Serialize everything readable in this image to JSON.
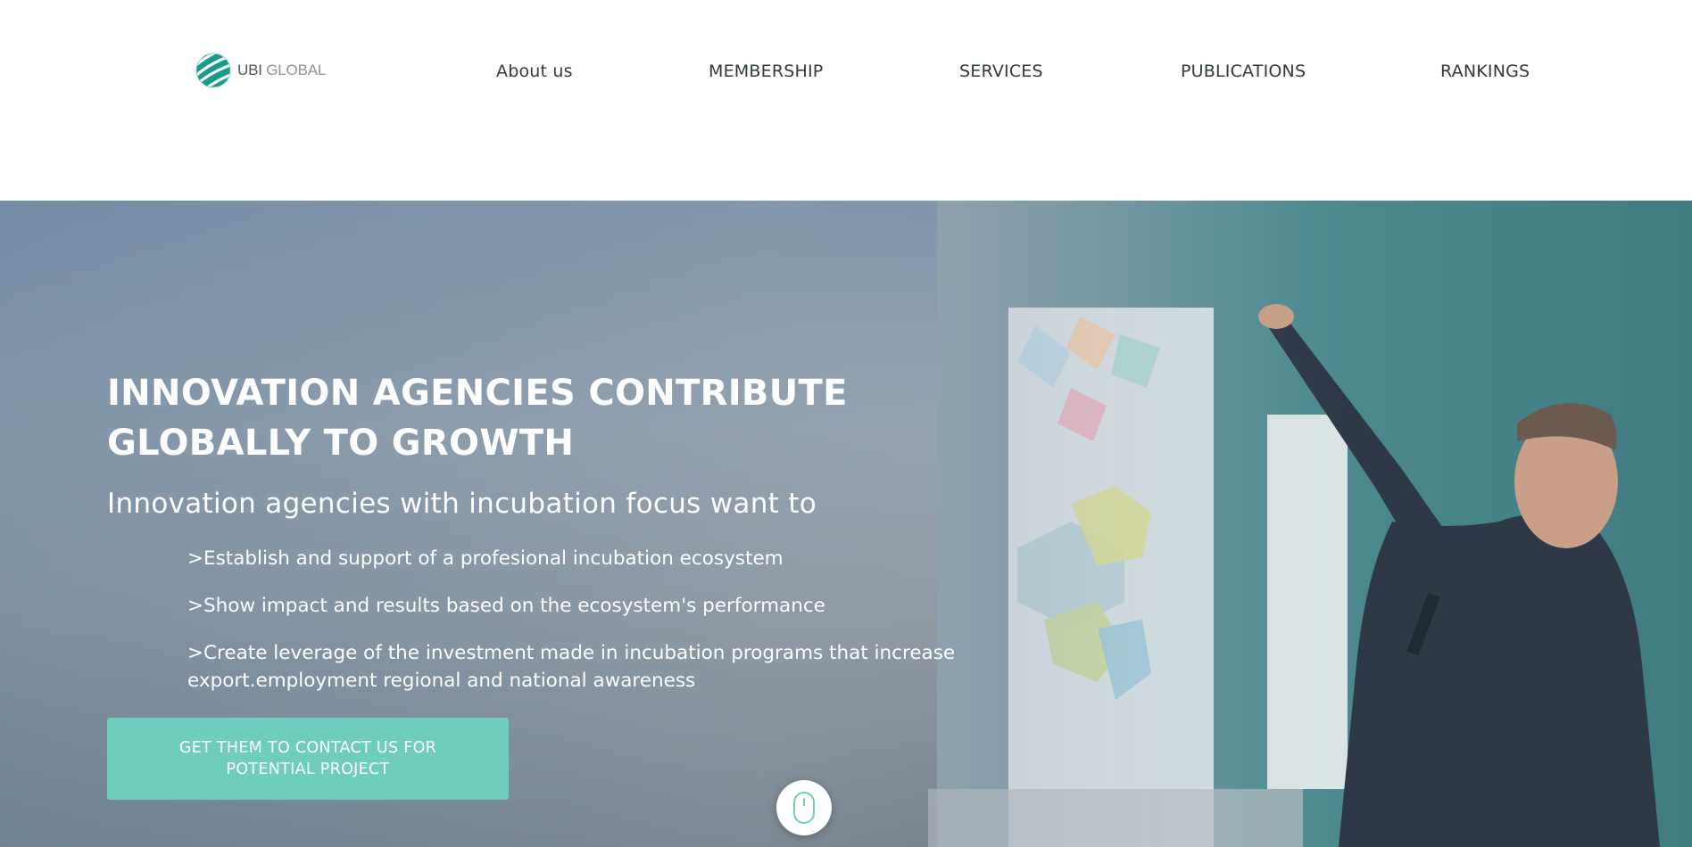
{
  "brand": {
    "logo_text_a": "UBI",
    "logo_text_b": " GLOBAL",
    "accent_color": "#6fcdbd",
    "icon": "globe-stripes-icon"
  },
  "nav": {
    "items": [
      {
        "label": "About us"
      },
      {
        "label": "MEMBERSHIP"
      },
      {
        "label": "SERVICES"
      },
      {
        "label": "PUBLICATIONS"
      },
      {
        "label": "RANKINGS"
      }
    ]
  },
  "hero": {
    "title": "INNOVATION AGENCIES CONTRIBUTE GLOBALLY TO GROWTH",
    "subtitle": "Innovation agencies with incubation focus want to",
    "bullets": [
      ">Establish and support of a profesional incubation ecosystem",
      ">Show impact and results based on the ecosystem's performance",
      ">Create leverage of the investment made in incubation programs that increase export.employment regional and national awareness"
    ],
    "cta_label": "GET THEM TO CONTACT US FOR POTENTIAL PROJECT",
    "scroll_icon": "mouse-scroll-icon"
  }
}
